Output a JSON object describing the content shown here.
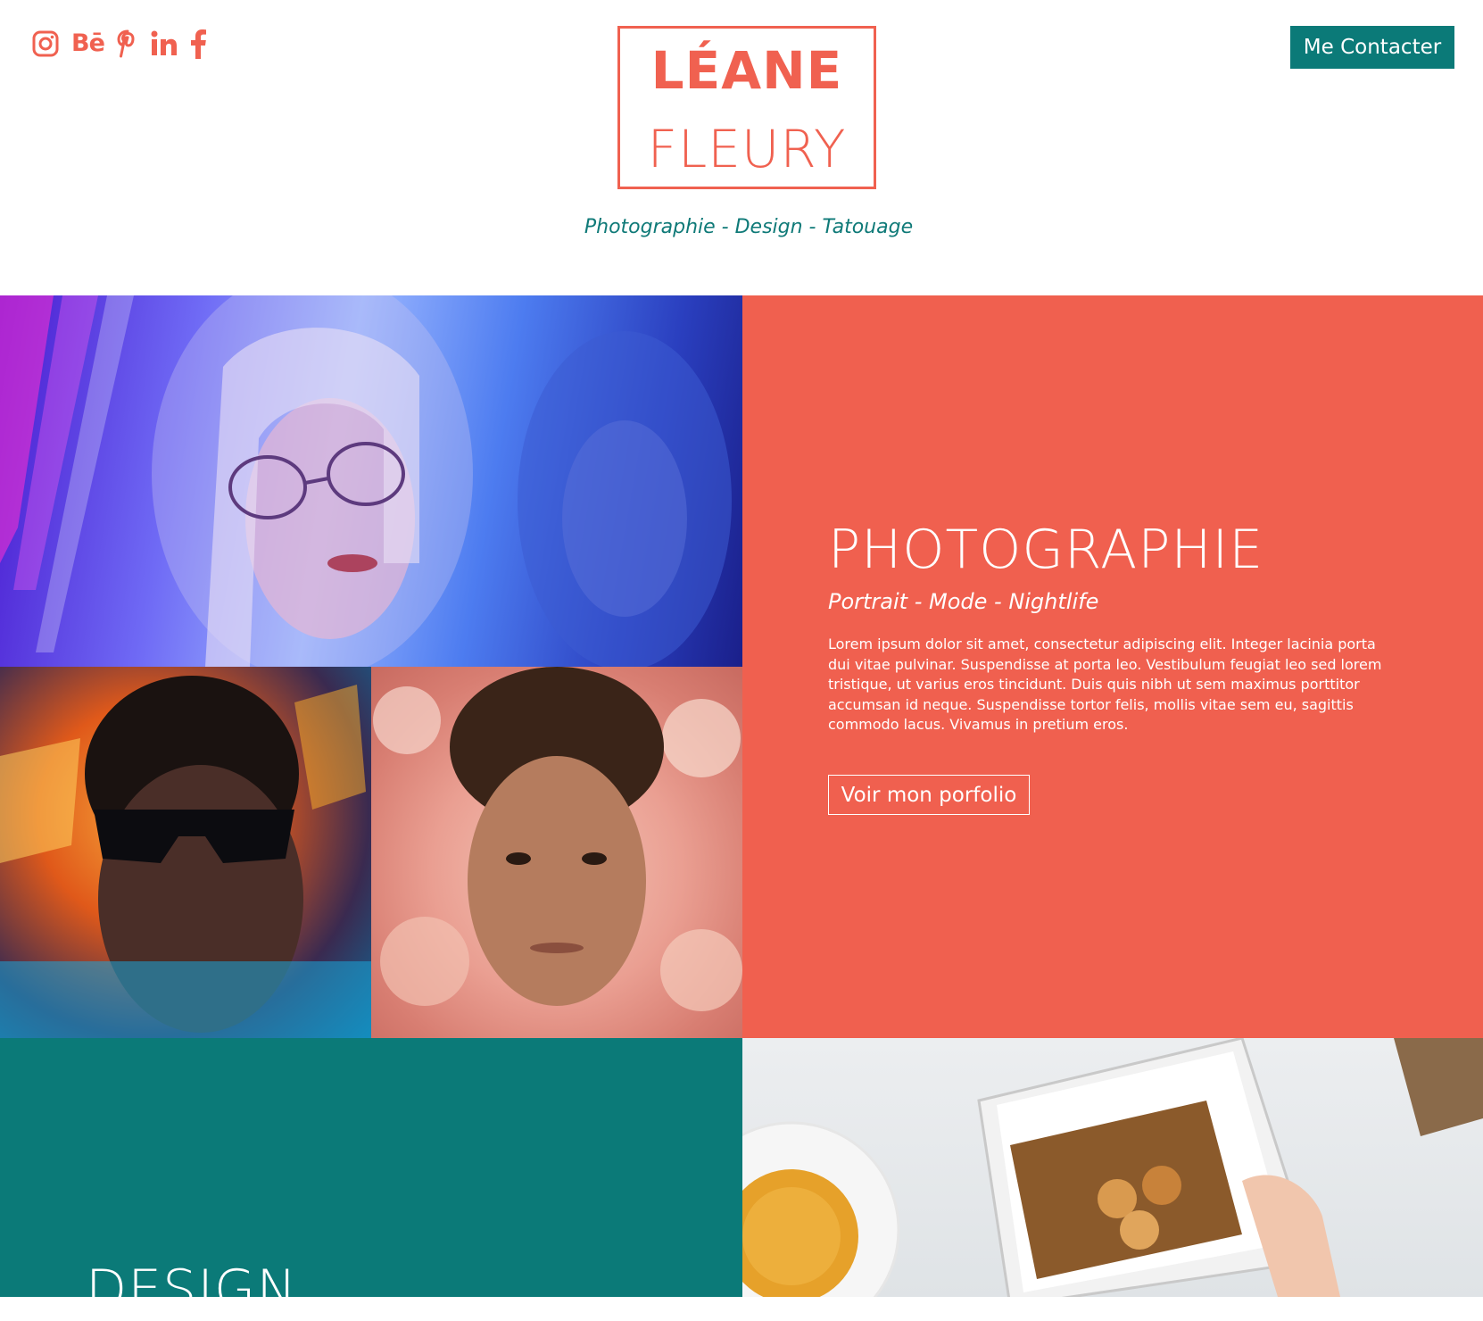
{
  "header": {
    "socials": [
      {
        "name": "instagram-icon"
      },
      {
        "name": "behance-icon",
        "text": "Bē"
      },
      {
        "name": "pinterest-icon"
      },
      {
        "name": "linkedin-icon"
      },
      {
        "name": "facebook-icon"
      }
    ],
    "logo": {
      "line1": "LÉANE",
      "line2": "FLEURY"
    },
    "tagline": "Photographie - Design - Tatouage",
    "contact_label": "Me Contacter"
  },
  "photography": {
    "title": "PHOTOGRAPHIE",
    "subtitle": "Portrait - Mode - Nightlife",
    "body": "Lorem ipsum dolor sit amet, consectetur adipiscing elit. Integer lacinia porta dui vitae pulvinar. Suspendisse at porta leo. Vestibulum feugiat leo sed lorem tristique, ut varius eros tincidunt. Duis quis nibh ut sem maximus porttitor accumsan id neque. Suspendisse tortor felis, mollis vitae sem eu, sagittis commodo lacus. Vivamus in pretium eros.",
    "button_label": "Voir mon porfolio"
  },
  "design": {
    "title": "DESIGN"
  },
  "colors": {
    "coral": "#f0604f",
    "teal": "#0b7a78",
    "white": "#ffffff"
  }
}
